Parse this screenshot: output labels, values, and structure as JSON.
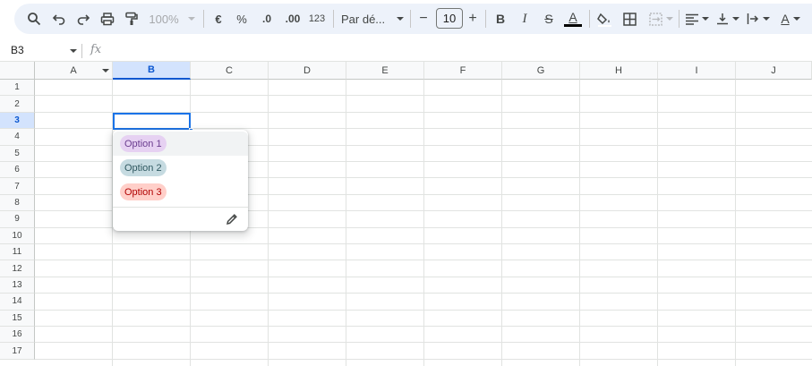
{
  "toolbar": {
    "zoom": "100%",
    "currency": "€",
    "percent": "%",
    "decrease_decimal": ".0",
    "increase_decimal": ".00",
    "number_format": "123",
    "font_name": "Par dé...",
    "font_size": "10",
    "minus": "−",
    "plus": "+",
    "bold": "B",
    "italic": "I",
    "strike": "S",
    "text_color_letter": "A",
    "text_color_bar": "#000000",
    "rotate_letter": "A"
  },
  "formula_bar": {
    "name_box": "B3",
    "fx": "fx"
  },
  "grid": {
    "columns": [
      "A",
      "B",
      "C",
      "D",
      "E",
      "F",
      "G",
      "H",
      "I",
      "J"
    ],
    "active_column": "B",
    "rows": [
      "1",
      "2",
      "3",
      "4",
      "5",
      "6",
      "7",
      "8",
      "9",
      "10",
      "11",
      "12",
      "13",
      "14",
      "15",
      "16",
      "17"
    ],
    "active_row": "3",
    "selection_color": "#1a73e8"
  },
  "dropdown": {
    "options": [
      {
        "label": "Option 1",
        "bg": "#e6d1f2",
        "fg": "#6a3c8f"
      },
      {
        "label": "Option 2",
        "bg": "#c6dbe1",
        "fg": "#2f5860"
      },
      {
        "label": "Option 3",
        "bg": "#ffcfc9",
        "fg": "#b10202"
      }
    ],
    "edit_icon": "pencil-icon"
  }
}
